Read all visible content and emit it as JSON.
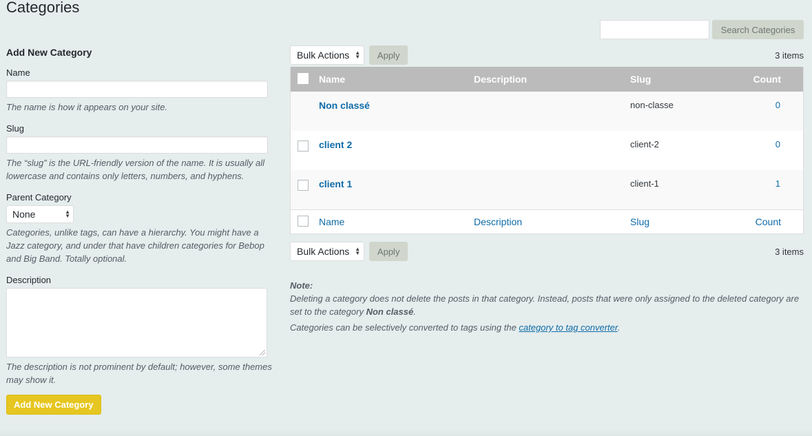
{
  "page": {
    "title": "Categories"
  },
  "add_form": {
    "heading": "Add New Category",
    "name": {
      "label": "Name",
      "value": "",
      "help": "The name is how it appears on your site."
    },
    "slug": {
      "label": "Slug",
      "value": "",
      "help": "The “slug” is the URL-friendly version of the name. It is usually all lowercase and contains only letters, numbers, and hyphens."
    },
    "parent": {
      "label": "Parent Category",
      "selected": "None",
      "help": "Categories, unlike tags, can have a hierarchy. You might have a Jazz category, and under that have children categories for Bebop and Big Band. Totally optional."
    },
    "description": {
      "label": "Description",
      "value": "",
      "help": "The description is not prominent by default; however, some themes may show it."
    },
    "submit_label": "Add New Category"
  },
  "search": {
    "value": "",
    "button_label": "Search Categories"
  },
  "tablenav_top": {
    "bulk_actions": "Bulk Actions",
    "apply_label": "Apply",
    "items_count": "3 items"
  },
  "tablenav_bottom": {
    "bulk_actions": "Bulk Actions",
    "apply_label": "Apply",
    "items_count": "3 items"
  },
  "table": {
    "columns": {
      "name": "Name",
      "description": "Description",
      "slug": "Slug",
      "count": "Count"
    },
    "rows": [
      {
        "name": "Non classé",
        "description": "",
        "slug": "non-classe",
        "count": "0",
        "has_checkbox": false
      },
      {
        "name": "client 2",
        "description": "",
        "slug": "client-2",
        "count": "0",
        "has_checkbox": true
      },
      {
        "name": "client 1",
        "description": "",
        "slug": "client-1",
        "count": "1",
        "has_checkbox": true
      }
    ]
  },
  "note": {
    "title": "Note:",
    "line1_prefix": "Deleting a category does not delete the posts in that category. Instead, posts that were only assigned to the deleted category are set to the category ",
    "line1_bold": "Non classé",
    "line1_suffix": ".",
    "line2_prefix": "Categories can be selectively converted to tags using the ",
    "line2_link": "category to tag converter",
    "line2_suffix": "."
  },
  "colors": {
    "accent_link": "#0f6ba8",
    "primary_button": "#e6c620",
    "header_bg": "#bbbbbb",
    "page_bg": "#e5eded"
  }
}
